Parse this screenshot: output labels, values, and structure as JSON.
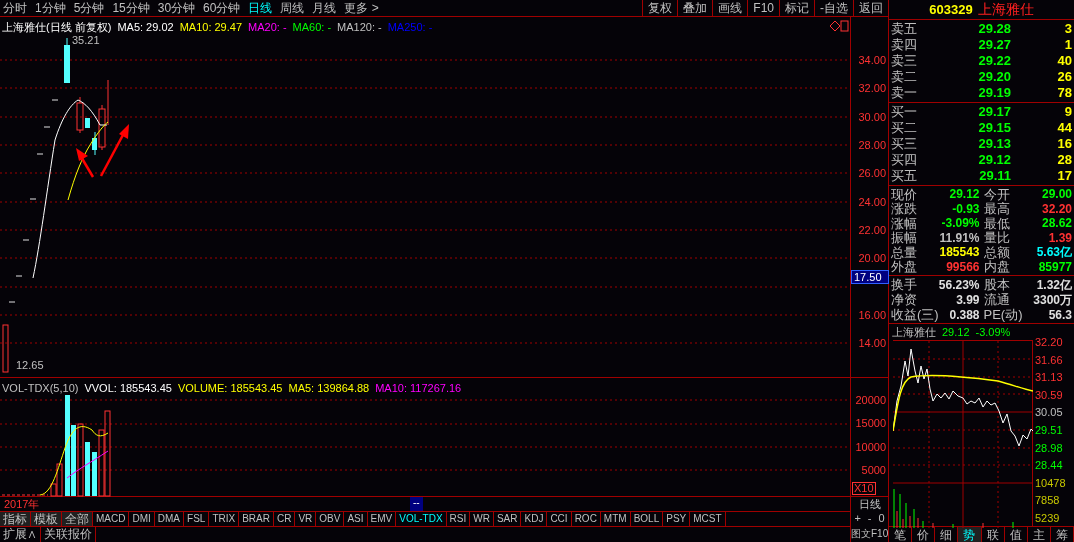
{
  "period_tabs": [
    {
      "label": "分时",
      "selected": false
    },
    {
      "label": "1分钟",
      "selected": false
    },
    {
      "label": "5分钟",
      "selected": false
    },
    {
      "label": "15分钟",
      "selected": false
    },
    {
      "label": "30分钟",
      "selected": false
    },
    {
      "label": "60分钟",
      "selected": false
    },
    {
      "label": "日线",
      "selected": true
    },
    {
      "label": "周线",
      "selected": false
    },
    {
      "label": "月线",
      "selected": false
    },
    {
      "label": "更多 >",
      "selected": false
    }
  ],
  "toolbar_buttons": [
    "复权",
    "叠加",
    "画线",
    "F10",
    "标记",
    "-自选",
    "返回"
  ],
  "stock_header": {
    "code": "603329",
    "name": "上海雅仕"
  },
  "chart_title": "上海雅仕(日线 前复权)",
  "chart_legend": [
    {
      "text": "MA5: 29.02",
      "color": "#ffffff"
    },
    {
      "text": "MA10: 29.47",
      "color": "#ffff00"
    },
    {
      "text": "MA20: -",
      "color": "#ff00ff"
    },
    {
      "text": "MA60: -",
      "color": "#00ff00"
    },
    {
      "text": "MA120: -",
      "color": "#c0c0c0"
    },
    {
      "text": "MA250: -",
      "color": "#0000ff"
    }
  ],
  "price_marks": {
    "high": "35.21",
    "low": "12.65"
  },
  "price_axis": [
    {
      "label": "34.00",
      "kind": "tick"
    },
    {
      "label": "32.00",
      "kind": "tick"
    },
    {
      "label": "30.00",
      "kind": "tick"
    },
    {
      "label": "28.00",
      "kind": "tick"
    },
    {
      "label": "26.00",
      "kind": "tick"
    },
    {
      "label": "24.00",
      "kind": "tick"
    },
    {
      "label": "22.00",
      "kind": "tick"
    },
    {
      "label": "20.00",
      "kind": "tick"
    },
    {
      "label": "17.50",
      "kind": "cursor"
    },
    {
      "label": "16.00",
      "kind": "tick"
    },
    {
      "label": "14.00",
      "kind": "tick"
    }
  ],
  "volume_legend": [
    {
      "text": "VOL-TDX(5,10)",
      "color": "#c0c0c0"
    },
    {
      "text": "VVOL: 185543.45",
      "color": "#ffffff"
    },
    {
      "text": "VOLUME: 185543.45",
      "color": "#ffff00"
    },
    {
      "text": "MA5: 139864.88",
      "color": "#ffff00"
    },
    {
      "text": "MA10: 117267.16",
      "color": "#ff00ff"
    }
  ],
  "volume_axis": [
    "20000",
    "15000",
    "10000",
    "5000"
  ],
  "volume_scale": "X10",
  "date_label": "2017年",
  "date_cursor": "--",
  "indicator_tabs": [
    {
      "label": "指标",
      "selected": false
    },
    {
      "label": "模板",
      "selected": false
    },
    {
      "label": "全部",
      "selected": false
    },
    {
      "label": "MACD",
      "selected": false
    },
    {
      "label": "DMI",
      "selected": false
    },
    {
      "label": "DMA",
      "selected": false
    },
    {
      "label": "FSL",
      "selected": false
    },
    {
      "label": "TRIX",
      "selected": false
    },
    {
      "label": "BRAR",
      "selected": false
    },
    {
      "label": "CR",
      "selected": false
    },
    {
      "label": "VR",
      "selected": false
    },
    {
      "label": "OBV",
      "selected": false
    },
    {
      "label": "ASI",
      "selected": false
    },
    {
      "label": "EMV",
      "selected": false
    },
    {
      "label": "VOL-TDX",
      "selected": true
    },
    {
      "label": "RSI",
      "selected": false
    },
    {
      "label": "WR",
      "selected": false
    },
    {
      "label": "SAR",
      "selected": false
    },
    {
      "label": "KDJ",
      "selected": false
    },
    {
      "label": "CCI",
      "selected": false
    },
    {
      "label": "ROC",
      "selected": false
    },
    {
      "label": "MTM",
      "selected": false
    },
    {
      "label": "BOLL",
      "selected": false
    },
    {
      "label": "PSY",
      "selected": false
    },
    {
      "label": "MCST",
      "selected": false
    }
  ],
  "bottom_buttons": [
    "扩展∧",
    "关联报价"
  ],
  "period_label": "日线",
  "zoom_controls": [
    "+",
    "-",
    "0"
  ],
  "f10_button": "图文F10",
  "asks": [
    {
      "label": "卖五",
      "price": "29.28",
      "volume": "3"
    },
    {
      "label": "卖四",
      "price": "29.27",
      "volume": "1"
    },
    {
      "label": "卖三",
      "price": "29.22",
      "volume": "40"
    },
    {
      "label": "卖二",
      "price": "29.20",
      "volume": "26"
    },
    {
      "label": "卖一",
      "price": "29.19",
      "volume": "78"
    }
  ],
  "bids": [
    {
      "label": "买一",
      "price": "29.17",
      "volume": "9"
    },
    {
      "label": "买二",
      "price": "29.15",
      "volume": "44"
    },
    {
      "label": "买三",
      "price": "29.13",
      "volume": "16"
    },
    {
      "label": "买四",
      "price": "29.12",
      "volume": "28"
    },
    {
      "label": "买五",
      "price": "29.11",
      "volume": "17"
    }
  ],
  "quote_stats": [
    [
      {
        "label": "现价",
        "value": "29.12",
        "color": "#00ff00"
      },
      {
        "label": "今开",
        "value": "29.00",
        "color": "#00ff00"
      }
    ],
    [
      {
        "label": "涨跌",
        "value": "-0.93",
        "color": "#00ff00"
      },
      {
        "label": "最高",
        "value": "32.20",
        "color": "#ff3232"
      }
    ],
    [
      {
        "label": "涨幅",
        "value": "-3.09%",
        "color": "#00ff00"
      },
      {
        "label": "最低",
        "value": "28.62",
        "color": "#00ff00"
      }
    ],
    [
      {
        "label": "振幅",
        "value": "11.91%",
        "color": "#c0c0c0"
      },
      {
        "label": "量比",
        "value": "1.39",
        "color": "#ff3232"
      }
    ],
    [
      {
        "label": "总量",
        "value": "185543",
        "color": "#ffff00"
      },
      {
        "label": "总额",
        "value": "5.63亿",
        "color": "#00ffff"
      }
    ],
    [
      {
        "label": "外盘",
        "value": "99566",
        "color": "#ff3232"
      },
      {
        "label": "内盘",
        "value": "85977",
        "color": "#00ff00"
      }
    ]
  ],
  "fundamentals": [
    [
      {
        "label": "换手",
        "value": "56.23%"
      },
      {
        "label": "股本",
        "value": "1.32亿"
      }
    ],
    [
      {
        "label": "净资",
        "value": "3.99"
      },
      {
        "label": "流通",
        "value": "3300万"
      }
    ],
    [
      {
        "label": "收益(三)",
        "value": "0.388"
      },
      {
        "label": "PE(动)",
        "value": "56.3"
      }
    ]
  ],
  "mini_chart": {
    "name": "上海雅仕",
    "price": "29.12",
    "change": "-3.09%",
    "price_axis": [
      {
        "label": "32.20",
        "color": "#ff3232"
      },
      {
        "label": "31.66",
        "color": "#ff3232"
      },
      {
        "label": "31.13",
        "color": "#ff3232"
      },
      {
        "label": "30.59",
        "color": "#ff3232"
      },
      {
        "label": "30.05",
        "color": "#c0c0c0"
      },
      {
        "label": "29.51",
        "color": "#00ff00"
      },
      {
        "label": "28.98",
        "color": "#00ff00"
      },
      {
        "label": "28.44",
        "color": "#00ff00"
      }
    ],
    "volume_axis": [
      "10478",
      "7858",
      "5239"
    ]
  },
  "bottom_tabs": [
    {
      "label": "笔",
      "selected": false
    },
    {
      "label": "价",
      "selected": false
    },
    {
      "label": "细",
      "selected": false
    },
    {
      "label": "势",
      "selected": true
    },
    {
      "label": "联",
      "selected": false
    },
    {
      "label": "值",
      "selected": false
    },
    {
      "label": "主",
      "selected": false
    },
    {
      "label": "筹",
      "selected": false
    }
  ]
}
